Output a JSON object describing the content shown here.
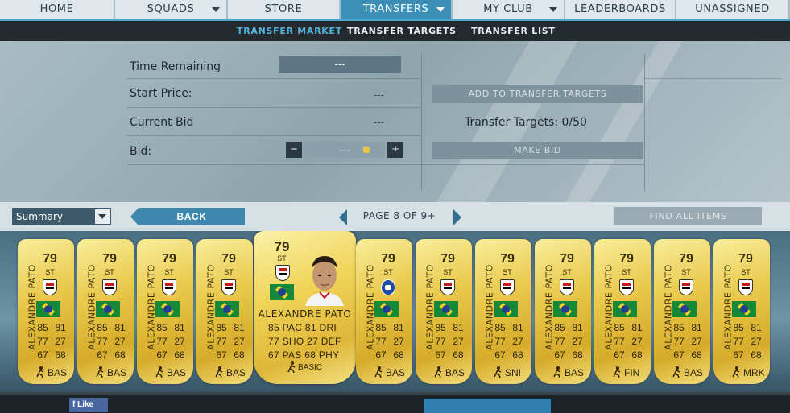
{
  "nav": {
    "items": [
      {
        "label": "HOME",
        "caret": false,
        "active": false
      },
      {
        "label": "SQUADS",
        "caret": true,
        "active": false
      },
      {
        "label": "STORE",
        "caret": false,
        "active": false
      },
      {
        "label": "TRANSFERS",
        "caret": true,
        "active": true
      },
      {
        "label": "MY CLUB",
        "caret": true,
        "active": false
      },
      {
        "label": "LEADERBOARDS",
        "caret": false,
        "active": false
      },
      {
        "label": "UNASSIGNED",
        "caret": false,
        "active": false
      }
    ],
    "sub_items": [
      {
        "label": "TRANSFER MARKET",
        "active": true
      },
      {
        "label": "TRANSFER TARGETS",
        "active": false
      },
      {
        "label": "TRANSFER LIST",
        "active": false
      }
    ]
  },
  "auction": {
    "time_remaining_label": "Time Remaining",
    "time_remaining_value": "---",
    "start_price_label": "Start Price:",
    "start_price_value": "---",
    "current_bid_label": "Current Bid",
    "current_bid_value": "---",
    "bid_label": "Bid:",
    "bid_value": "---",
    "minus": "−",
    "plus": "+",
    "add_targets_button": "ADD TO TRANSFER TARGETS",
    "targets_count": "Transfer Targets: 0/50",
    "make_bid_button": "MAKE BID"
  },
  "controls": {
    "view_select": "Summary",
    "back_button": "BACK",
    "page_label": "PAGE 8 OF 9+",
    "find_all_button": "FIND ALL ITEMS"
  },
  "cards": [
    {
      "rating": "79",
      "position": "ST",
      "name": "ALEXANDRE PATO",
      "club": "spfc",
      "pac": "85",
      "sho": "77",
      "pas": "67",
      "dri": "81",
      "def": "27",
      "phy": "68",
      "chem": "BAS"
    },
    {
      "rating": "79",
      "position": "ST",
      "name": "ALEXANDRE PATO",
      "club": "spfc",
      "pac": "85",
      "sho": "77",
      "pas": "67",
      "dri": "81",
      "def": "27",
      "phy": "68",
      "chem": "BAS"
    },
    {
      "rating": "79",
      "position": "ST",
      "name": "ALEXANDRE PATO",
      "club": "spfc",
      "pac": "85",
      "sho": "77",
      "pas": "67",
      "dri": "81",
      "def": "27",
      "phy": "68",
      "chem": "BAS"
    },
    {
      "rating": "79",
      "position": "ST",
      "name": "ALEXANDRE PATO",
      "club": "spfc",
      "pac": "85",
      "sho": "77",
      "pas": "67",
      "dri": "81",
      "def": "27",
      "phy": "68",
      "chem": "BAS"
    },
    {
      "rating": "79",
      "position": "ST",
      "name": "ALEXANDRE PATO",
      "club": "chelsea",
      "pac": "85",
      "sho": "77",
      "pas": "67",
      "dri": "81",
      "def": "27",
      "phy": "68",
      "chem": "BAS"
    },
    {
      "rating": "79",
      "position": "ST",
      "name": "ALEXANDRE PATO",
      "club": "spfc",
      "pac": "85",
      "sho": "77",
      "pas": "67",
      "dri": "81",
      "def": "27",
      "phy": "68",
      "chem": "BAS"
    },
    {
      "rating": "79",
      "position": "ST",
      "name": "ALEXANDRE PATO",
      "club": "spfc",
      "pac": "85",
      "sho": "77",
      "pas": "67",
      "dri": "81",
      "def": "27",
      "phy": "68",
      "chem": "SNI"
    },
    {
      "rating": "79",
      "position": "ST",
      "name": "ALEXANDRE PATO",
      "club": "spfc",
      "pac": "85",
      "sho": "77",
      "pas": "67",
      "dri": "81",
      "def": "27",
      "phy": "68",
      "chem": "BAS"
    },
    {
      "rating": "79",
      "position": "ST",
      "name": "ALEXANDRE PATO",
      "club": "spfc",
      "pac": "85",
      "sho": "77",
      "pas": "67",
      "dri": "81",
      "def": "27",
      "phy": "68",
      "chem": "FIN"
    },
    {
      "rating": "79",
      "position": "ST",
      "name": "ALEXANDRE PATO",
      "club": "spfc",
      "pac": "85",
      "sho": "77",
      "pas": "67",
      "dri": "81",
      "def": "27",
      "phy": "68",
      "chem": "BAS"
    },
    {
      "rating": "79",
      "position": "ST",
      "name": "ALEXANDRE PATO",
      "club": "spfc",
      "pac": "85",
      "sho": "77",
      "pas": "67",
      "dri": "81",
      "def": "27",
      "phy": "68",
      "chem": "MRK"
    }
  ],
  "selected_card": {
    "rating": "79",
    "position": "ST",
    "name": "ALEXANDRE PATO",
    "club": "spfc",
    "stats_line1": "85 PAC  81 DRI",
    "stats_line2": "77 SHO  27 DEF",
    "stats_line3": "67 PAS  68 PHY",
    "chem": "BASIC"
  },
  "footer": {
    "fb_label": "f Like"
  },
  "colors": {
    "accent": "#3b8fb6",
    "gold": "#e9c84a"
  }
}
